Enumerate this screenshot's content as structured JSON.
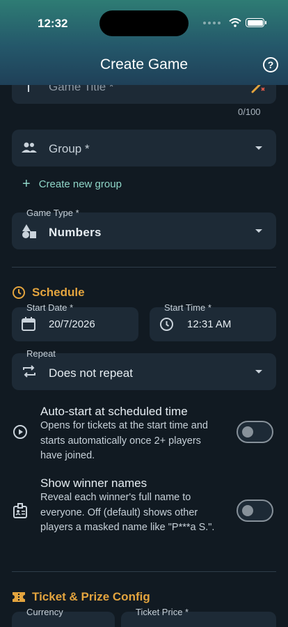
{
  "status_bar": {
    "time": "12:32"
  },
  "app_bar": {
    "title": "Create Game",
    "help_icon": "help-circle-icon"
  },
  "game_title": {
    "placeholder": "Game Title *",
    "counter": "0/100",
    "icon": "magic-wand-icon"
  },
  "group": {
    "label": "Group *",
    "icon": "people-icon"
  },
  "create_group": {
    "label": "Create new group",
    "icon": "plus-icon"
  },
  "game_type": {
    "label": "Game Type *",
    "value": "Numbers",
    "icon": "shapes-icon"
  },
  "schedule": {
    "title": "Schedule",
    "start_date": {
      "label": "Start Date *",
      "value": "20/7/2026"
    },
    "start_time": {
      "label": "Start Time *",
      "value": "12:31 AM"
    },
    "repeat": {
      "label": "Repeat",
      "value": "Does not repeat"
    },
    "auto_start": {
      "title": "Auto-start at scheduled time",
      "description": "Opens for tickets at the start time and starts automatically once 2+ players have joined.",
      "enabled": false
    },
    "winner_names": {
      "title": "Show winner names",
      "description": "Reveal each winner's full name to everyone. Off (default) shows other players a masked name like \"P***a S.\".",
      "enabled": false
    }
  },
  "ticket_prize": {
    "title": "Ticket & Prize Config",
    "currency_label": "Currency",
    "ticket_price_label": "Ticket Price *"
  },
  "colors": {
    "accent": "#e3a43e",
    "link": "#8fd6c8",
    "field_bg": "#1d2a36",
    "background": "#111a22"
  }
}
